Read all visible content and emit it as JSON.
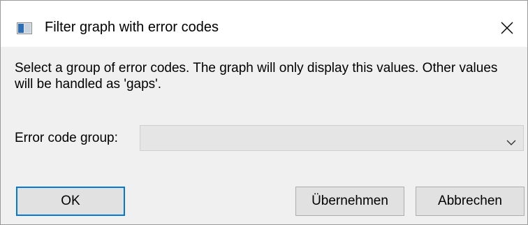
{
  "window": {
    "title": "Filter graph with error codes",
    "icon": "window-app-icon",
    "close_icon": "close-icon"
  },
  "dialog": {
    "message": "Select a group of error codes. The graph will only display this values. Other values will be handled as 'gaps'.",
    "error_code_group": {
      "label": "Error code group:",
      "selected_value": "",
      "icon": "chevron-down-icon"
    }
  },
  "buttons": {
    "ok": "OK",
    "apply": "Übernehmen",
    "cancel": "Abbrechen"
  },
  "colors": {
    "focus_border": "#0078d7",
    "button_bg": "#e1e1e1",
    "dialog_bg": "#f0f0f0"
  }
}
